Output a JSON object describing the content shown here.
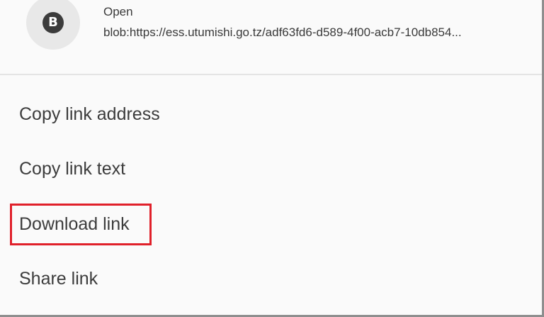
{
  "header": {
    "avatar_letter": "B",
    "open_label": "Open",
    "url": "blob:https://ess.utumishi.go.tz/adf63fd6-d589-4f00-acb7-10db854..."
  },
  "menu_items": [
    {
      "label": "Copy link address"
    },
    {
      "label": "Copy link text"
    },
    {
      "label": "Download link",
      "highlighted": true
    },
    {
      "label": "Share link"
    }
  ],
  "colors": {
    "menu_background": "#fafafa",
    "backdrop": "#8e8e8e",
    "highlight": "#e0202a",
    "avatar_bg": "#3c3c3c",
    "text": "#3c3c3c"
  }
}
